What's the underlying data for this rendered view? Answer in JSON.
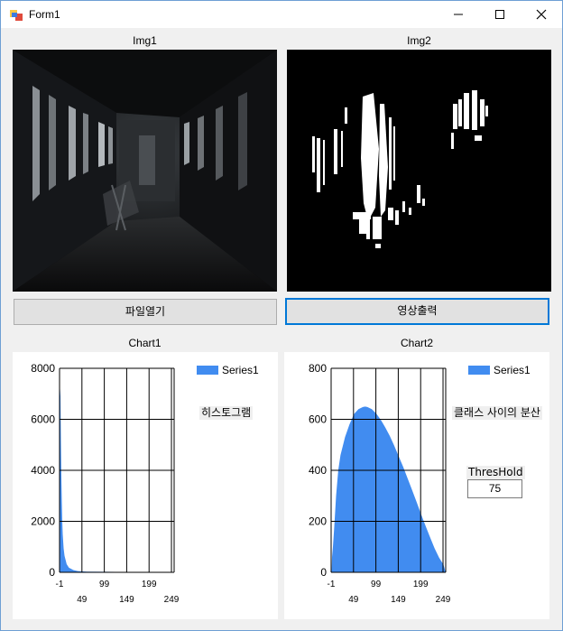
{
  "window": {
    "title": "Form1"
  },
  "captions": {
    "img1": "Img1",
    "img2": "Img2",
    "chart1": "Chart1",
    "chart2": "Chart2"
  },
  "buttons": {
    "open_file": "파일열기",
    "show_image": "영상출력"
  },
  "chart1_labels": {
    "legend": "Series1",
    "tag": "히스토그램"
  },
  "chart2_labels": {
    "legend": "Series1",
    "tag": "클래스 사이의 분산",
    "threshold_label": "ThresHold",
    "threshold_value": "75"
  },
  "colors": {
    "series": "#418cf0",
    "accent": "#0078d7"
  },
  "chart_data": [
    {
      "type": "area",
      "title": "Chart1",
      "series": [
        {
          "name": "Series1"
        }
      ],
      "x": [
        0,
        1,
        2,
        3,
        4,
        5,
        6,
        8,
        10,
        15,
        20,
        30,
        40,
        60,
        100,
        150,
        200,
        255
      ],
      "values": [
        7200,
        6900,
        5200,
        3800,
        2800,
        2000,
        1500,
        950,
        650,
        320,
        180,
        90,
        50,
        30,
        20,
        10,
        5,
        0
      ],
      "xlim": [
        -1,
        255
      ],
      "ylim": [
        0,
        8000
      ],
      "x_ticks": [
        "-1",
        "49",
        "99",
        "149",
        "199",
        "249"
      ],
      "y_ticks": [
        "0",
        "2000",
        "4000",
        "6000",
        "8000"
      ],
      "grid": true,
      "legend": "top-right"
    },
    {
      "type": "area",
      "title": "Chart2",
      "series": [
        {
          "name": "Series1"
        }
      ],
      "x": [
        0,
        1,
        3,
        6,
        10,
        15,
        20,
        30,
        40,
        50,
        60,
        70,
        75,
        80,
        90,
        100,
        110,
        120,
        130,
        140,
        150,
        160,
        170,
        180,
        190,
        200,
        210,
        220,
        230,
        240,
        250,
        255
      ],
      "values": [
        0,
        60,
        100,
        180,
        300,
        400,
        460,
        530,
        580,
        620,
        640,
        648,
        650,
        648,
        640,
        622,
        598,
        568,
        535,
        497,
        455,
        413,
        368,
        322,
        275,
        228,
        182,
        138,
        95,
        58,
        30,
        0
      ],
      "xlim": [
        -1,
        255
      ],
      "ylim": [
        0,
        800
      ],
      "x_ticks": [
        "-1",
        "49",
        "99",
        "149",
        "199",
        "249"
      ],
      "y_ticks": [
        "0",
        "200",
        "400",
        "600",
        "800"
      ],
      "grid": true,
      "legend": "top-right"
    }
  ]
}
